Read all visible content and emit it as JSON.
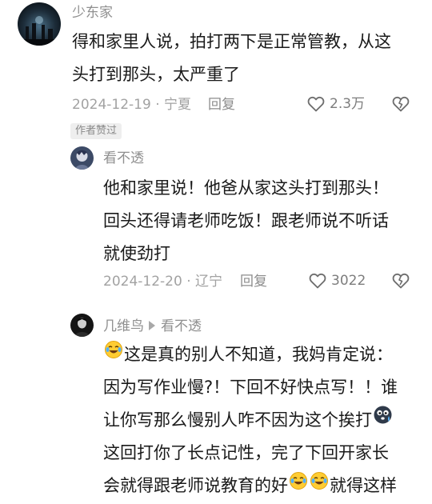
{
  "comments": [
    {
      "user": "少东家",
      "lines": [
        "得和家里人说，拍打两下是正常管教，从这",
        "头打到那头，太严重了"
      ],
      "date_location": "2024-12-19 · 宁夏",
      "reply_label": "回复",
      "likes": "2.3万",
      "badge": "作者赞过"
    },
    {
      "user": "看不透",
      "lines": [
        "他和家里说！他爸从家这头打到那头！",
        "回头还得请老师吃饭！跟老师说不听话",
        "就使劲打"
      ],
      "date_location": "2024-12-20 · 辽宁",
      "reply_label": "回复",
      "likes": "3022"
    },
    {
      "user": "几维鸟",
      "reply_to": "看不透",
      "line1": "这是真的别人不知道，我妈肯定说：",
      "line2": "因为写作业慢?！下回不好快点写！！谁",
      "line3": "让你写那么慢别人咋不因为这个挨打",
      "line4": "这回打你了长点记性，完了下回开家长",
      "line5_a": "会就得跟老师说教育的好",
      "line5_b": "就得这样",
      "emojis": [
        "laugh-cry",
        "frightened-face"
      ]
    }
  ],
  "colors": {
    "primary_text": "#1a1a1a",
    "secondary_text": "#8f8f8f",
    "badge_bg": "#eeeeee"
  }
}
